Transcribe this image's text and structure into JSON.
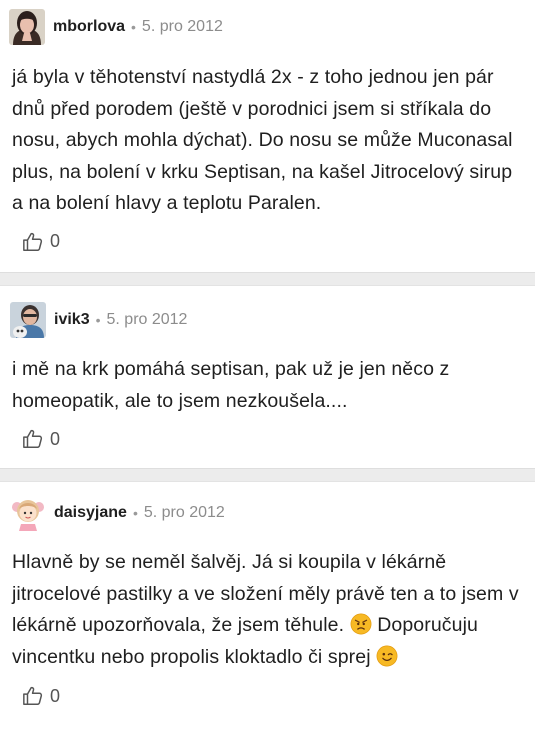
{
  "comments": [
    {
      "author": "mborlova",
      "separator": "•",
      "date": "5. pro 2012",
      "text": "já byla v těhotenství nastydlá 2x - z toho jednou jen pár dnů před porodem (ještě v porodnici jsem si stříkala do nosu, abych mohla dýchat). Do nosu se může Muconasal plus, na bolení v krku Septisan, na kašel Jitrocelový sirup a na bolení hlavy a teplotu Paralen.",
      "likes": "0",
      "avatar_icon": "woman-portrait-avatar"
    },
    {
      "author": "ivik3",
      "separator": "•",
      "date": "5. pro 2012",
      "text": "i mě na krk pomáhá septisan, pak už je jen něco z homeopatik, ale to jsem nezkoušela....",
      "likes": "0",
      "avatar_icon": "photo-avatar"
    },
    {
      "author": "daisyjane",
      "separator": "•",
      "date": "5. pro 2012",
      "text_part1": "Hlavně by se neměl šalvěj. Já si koupila v lékárně jitrocelové pastilky a ve složení měly právě ten a to jsem v lékárně upozorňovala, že jsem těhule.",
      "text_part2": "Doporučuju vincentku nebo propolis kloktadlo či sprej",
      "likes": "0",
      "avatar_icon": "cartoon-girl-avatar",
      "emoji_1": "angry-face-emoji",
      "emoji_2": "winking-face-emoji"
    }
  ],
  "icons": {
    "like": "thumbs-up-icon"
  },
  "colors": {
    "divider": "#ececec",
    "meta": "#8c8c8c",
    "text": "#1f1f1f",
    "emoji": "#f7b924"
  }
}
